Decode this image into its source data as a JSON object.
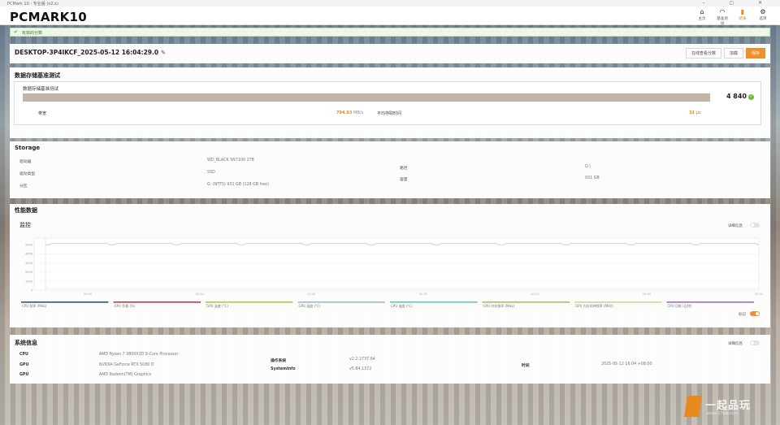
{
  "window": {
    "title": "PCMark 10 - 专业版 (v2.x)",
    "controls": "–  ▢  ✕"
  },
  "header": {
    "logo_main": "PCMARK",
    "logo_num": "10",
    "nav": [
      {
        "icon": "home-icon",
        "glyph": "⌂",
        "label": "主页"
      },
      {
        "icon": "benchmark-icon",
        "glyph": "◠",
        "label": "基准测试"
      },
      {
        "icon": "results-icon",
        "glyph": "▮",
        "label": "结果"
      },
      {
        "icon": "settings-icon",
        "glyph": "⚙",
        "label": "选项"
      }
    ]
  },
  "banner": {
    "text": "有效的分数"
  },
  "result": {
    "name": "DESKTOP-3P4IKCF_2025-05-12 16:04:29.0",
    "buttons": {
      "compare": "在线查看分数",
      "load": "加载",
      "save": "保存"
    }
  },
  "storage_test": {
    "title": "数据存储基准测试",
    "test_name": "数据存储基准测试",
    "score": "4 840",
    "bar_fraction": 0.94,
    "metrics": [
      {
        "label": "带宽",
        "value": "794.93",
        "unit": "MB/s"
      },
      {
        "label": "平均存取时间",
        "value": "32",
        "unit": "μs"
      }
    ]
  },
  "storage": {
    "title": "Storage",
    "rows": [
      {
        "label": "驱动器",
        "value": "WD_BLACK SN7100 1TB"
      },
      {
        "label": "驱动类型",
        "value": "SSD"
      },
      {
        "label": "分区",
        "value": "G: (NTFS) 931 GB (128 GB free)"
      }
    ],
    "right_rows": [
      {
        "label": "路径",
        "value": "G:\\"
      },
      {
        "label": "容量",
        "value": "931 GB"
      }
    ]
  },
  "perf": {
    "title": "性能数据",
    "monitor_title": "监控",
    "details_toggle_label": "详细信息",
    "legend": [
      {
        "label": "CPU 频率 (MHz)",
        "color": "#1f5c7a"
      },
      {
        "label": "GPU 负载 (%)",
        "color": "#c2384a"
      },
      {
        "label": "GPU 温度 (°C)",
        "color": "#bcc43a"
      },
      {
        "label": "GPU 温度 (°C)",
        "color": "#9bb9cc"
      },
      {
        "label": "CPU 温度 (°C)",
        "color": "#5fc7b4"
      },
      {
        "label": "GPU 内存频率 (MHz)",
        "color": "#97c95a"
      },
      {
        "label": "GPU 内存时钟频率 (MHz)",
        "color": "#d9d18e"
      },
      {
        "label": "CPU 功耗 (瓦特)",
        "color": "#9b6fc4"
      }
    ],
    "markers_label": "标记",
    "y_ticks": [
      "5000",
      "4000",
      "3000",
      "2000",
      "1000",
      "0"
    ],
    "x_ticks": [
      "00:00",
      "00:20",
      "00:40",
      "01:00",
      "01:20",
      "01:40",
      "02:00"
    ]
  },
  "sysinfo": {
    "title": "系统信息",
    "details_toggle_label": "详细信息",
    "rows": [
      {
        "label": "CPU",
        "value": "AMD Ryzen 7 9800X3D 8-Core Processor"
      },
      {
        "label": "GPU",
        "value": "NVIDIA GeForce RTX 5080 D"
      },
      {
        "label": "GPU",
        "value": "AMD Radeon(TM) Graphics"
      }
    ],
    "mid_rows": [
      {
        "label": "操作系统",
        "value": "v2.2.2737.64"
      },
      {
        "label": "SystemInfo",
        "value": "v5.84.1372"
      }
    ],
    "right_rows": [
      {
        "label": "时间",
        "value": "2025-05-12 16:04 +08:00"
      }
    ]
  },
  "watermark": {
    "text": "一起品玩",
    "url": "www.17pw.com"
  }
}
